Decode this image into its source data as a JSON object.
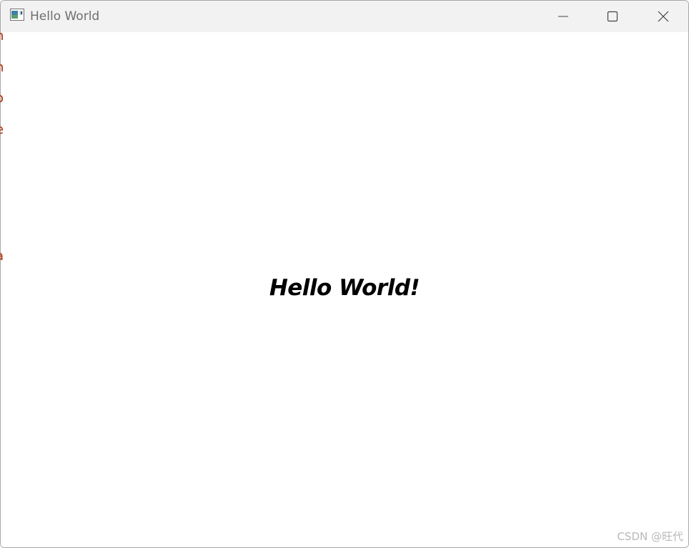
{
  "window": {
    "title": "Hello World",
    "icon": "app-window-icon"
  },
  "caption_buttons": {
    "minimize_icon": "minimize-icon",
    "maximize_icon": "maximize-icon",
    "close_icon": "close-icon"
  },
  "content": {
    "label": "Hello World!"
  },
  "edge_fragments": [
    "n",
    "n",
    "o",
    "e",
    "a"
  ],
  "watermark": "CSDN @旺代",
  "colors": {
    "titlebar_bg": "#f2f2f2",
    "title_text": "#6e6e6e",
    "label_text": "#000000",
    "edge_fragment_text": "#b02a00"
  }
}
